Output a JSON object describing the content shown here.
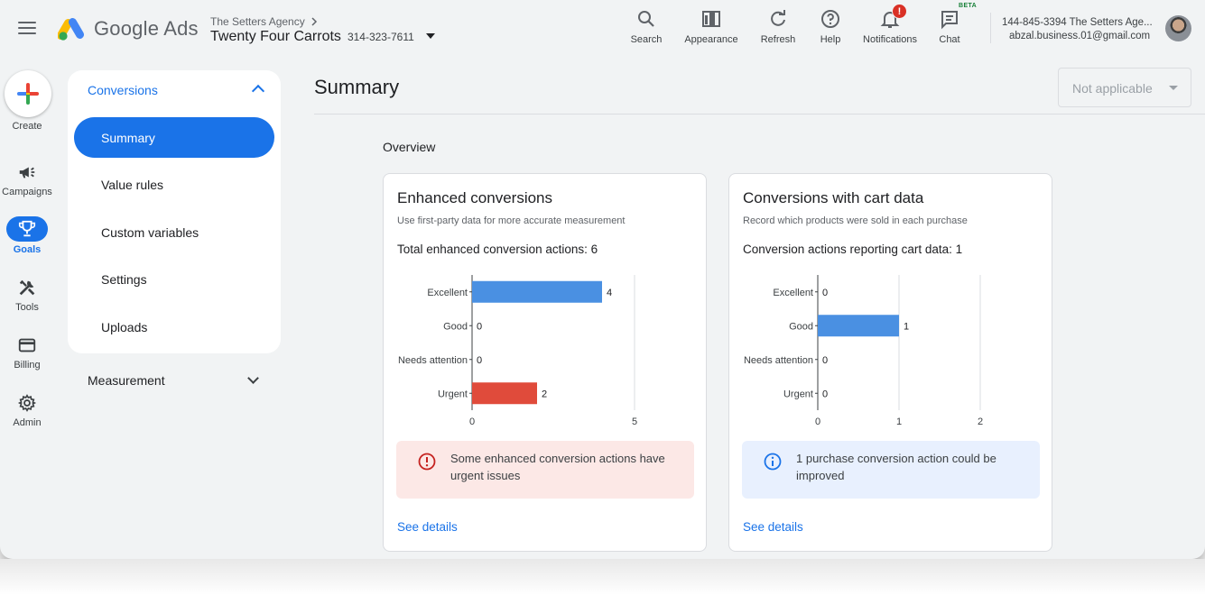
{
  "header": {
    "brand": "Google Ads",
    "agency": "The Setters Agency",
    "account_name": "Twenty Four Carrots",
    "account_id": "314-323-7611",
    "tools": [
      {
        "label": "Search",
        "icon": "search-icon"
      },
      {
        "label": "Appearance",
        "icon": "appearance-icon"
      },
      {
        "label": "Refresh",
        "icon": "refresh-icon"
      },
      {
        "label": "Help",
        "icon": "help-icon"
      },
      {
        "label": "Notifications",
        "icon": "bell-icon",
        "badge": "!"
      },
      {
        "label": "Chat",
        "icon": "chat-icon",
        "tag": "BETA"
      }
    ],
    "user_line": "144-845-3394 The Setters Age...",
    "user_email": "abzal.business.01@gmail.com"
  },
  "rail": {
    "create": "Create",
    "items": [
      {
        "label": "Campaigns",
        "icon": "megaphone-icon"
      },
      {
        "label": "Goals",
        "icon": "trophy-icon",
        "active": true
      },
      {
        "label": "Tools",
        "icon": "tools-icon"
      },
      {
        "label": "Billing",
        "icon": "credit-card-icon"
      },
      {
        "label": "Admin",
        "icon": "gear-icon"
      }
    ]
  },
  "nav": {
    "section": "Conversions",
    "items": [
      "Summary",
      "Value rules",
      "Custom variables",
      "Settings",
      "Uploads"
    ],
    "active": "Summary",
    "section2": "Measurement"
  },
  "main": {
    "title": "Summary",
    "select_value": "Not applicable",
    "overview": "Overview"
  },
  "cards": [
    {
      "title": "Enhanced conversions",
      "subtitle": "Use first-party data for more accurate measurement",
      "total": "Total enhanced conversion actions: 6",
      "alert": "Some enhanced conversion actions have urgent issues",
      "alert_type": "error",
      "link": "See details"
    },
    {
      "title": "Conversions with cart data",
      "subtitle": "Record which products were sold in each purchase",
      "total": "Conversion actions reporting cart data: 1",
      "alert": "1 purchase conversion action could be improved",
      "alert_type": "info",
      "link": "See details"
    }
  ],
  "colors": {
    "accent": "#1a73e8",
    "bar_blue": "#4a90e2",
    "bar_red": "#e04b3b",
    "error_bg": "#fce8e6",
    "info_bg": "#e8f0fe"
  },
  "chart_data": [
    {
      "type": "bar",
      "orientation": "horizontal",
      "categories": [
        "Excellent",
        "Good",
        "Needs attention",
        "Urgent"
      ],
      "values": [
        4,
        0,
        0,
        2
      ],
      "bar_colors": [
        "#4a90e2",
        "#4a90e2",
        "#4a90e2",
        "#e04b3b"
      ],
      "xlim": [
        0,
        5
      ],
      "xticks": [
        0,
        5
      ],
      "grid": true
    },
    {
      "type": "bar",
      "orientation": "horizontal",
      "categories": [
        "Excellent",
        "Good",
        "Needs attention",
        "Urgent"
      ],
      "values": [
        0,
        1,
        0,
        0
      ],
      "bar_colors": [
        "#4a90e2",
        "#4a90e2",
        "#4a90e2",
        "#4a90e2"
      ],
      "xlim": [
        0,
        2
      ],
      "xticks": [
        0,
        1,
        2
      ],
      "grid": true
    }
  ]
}
